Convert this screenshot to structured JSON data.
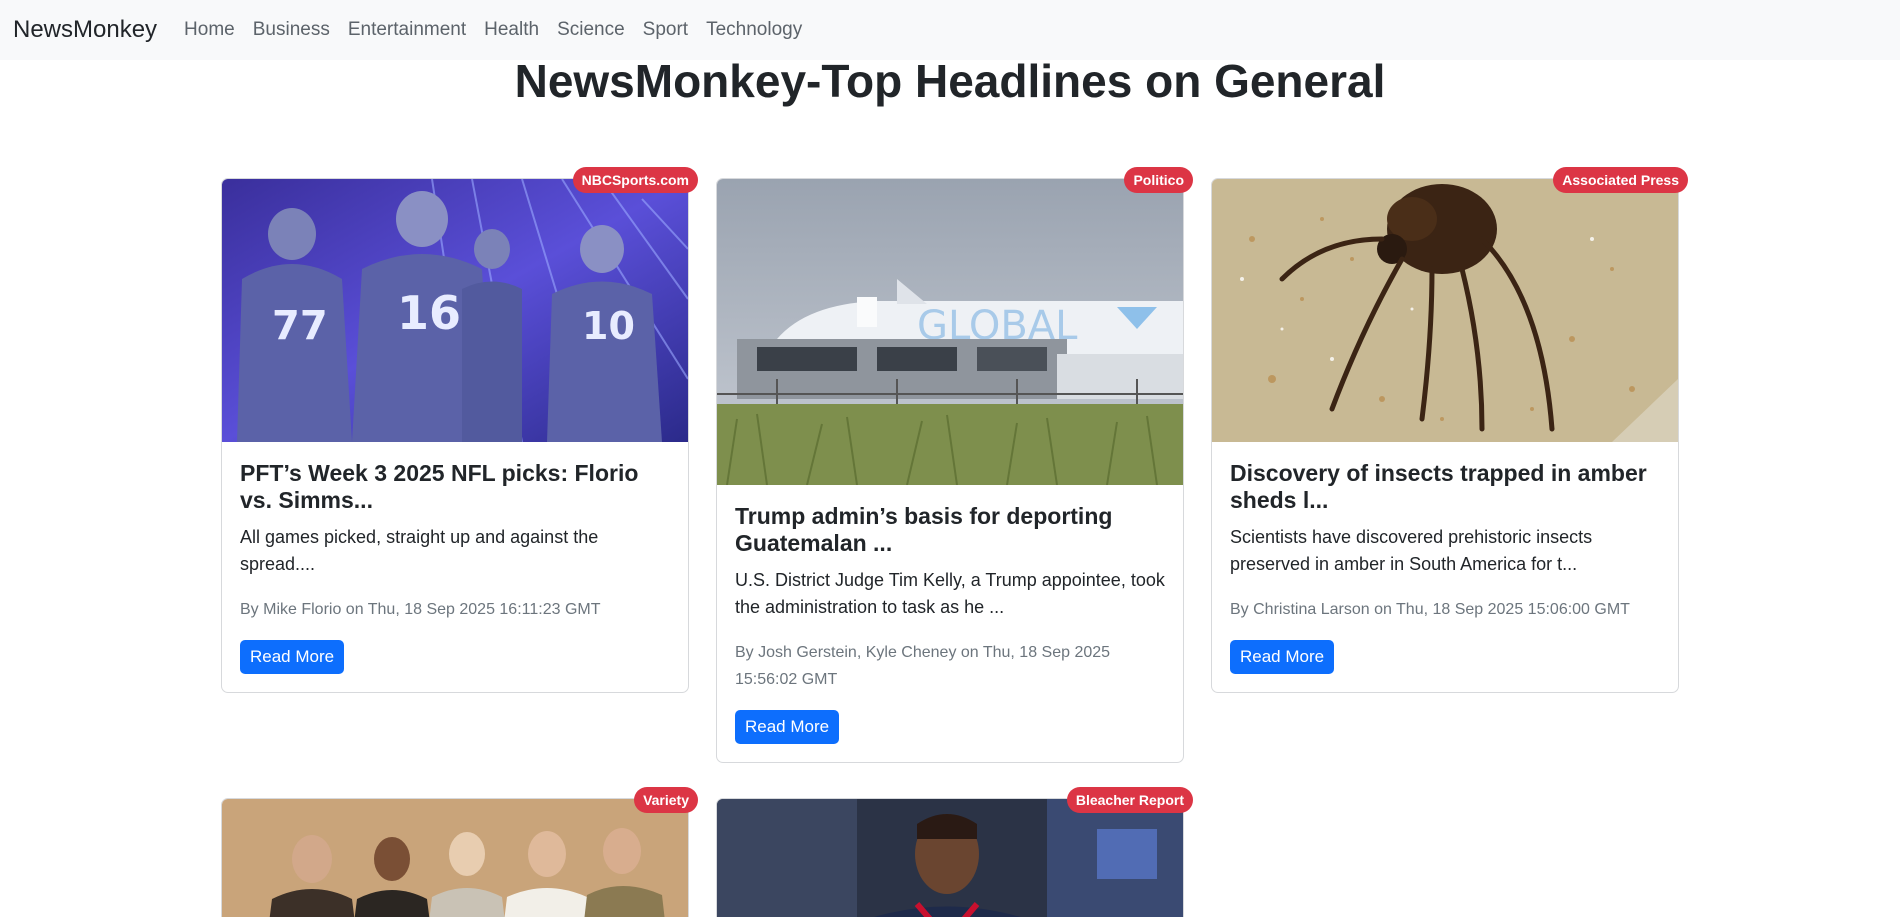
{
  "navbar": {
    "brand": "NewsMonkey",
    "links": [
      "Home",
      "Business",
      "Entertainment",
      "Health",
      "Science",
      "Sport",
      "Technology"
    ]
  },
  "page": {
    "title": "NewsMonkey-Top Headlines on General"
  },
  "articles": [
    {
      "source": "NBCSports.com",
      "title": "PFT’s Week 3 2025 NFL picks: Florio vs. Simms...",
      "description": "All games picked, straight up and against the spread....",
      "meta": "By Mike Florio on Thu, 18 Sep 2025 16:11:23 GMT",
      "button": "Read More"
    },
    {
      "source": "Politico",
      "title": "Trump admin’s basis for deporting Guatemalan ...",
      "description": "U.S. District Judge Tim Kelly, a Trump appointee, took the administration to task as he ...",
      "meta": "By Josh Gerstein, Kyle Cheney on Thu, 18 Sep 2025 15:56:02 GMT",
      "button": "Read More"
    },
    {
      "source": "Associated Press",
      "title": "Discovery of insects trapped in amber sheds l...",
      "description": "Scientists have discovered prehistoric insects preserved in amber in South America for t...",
      "meta": "By Christina Larson on Thu, 18 Sep 2025 15:06:00 GMT",
      "button": "Read More"
    },
    {
      "source": "Variety"
    },
    {
      "source": "Bleacher Report"
    }
  ],
  "images": {
    "jersey_numbers": [
      "77",
      "16",
      "10"
    ],
    "plane_text": "GLOBAL"
  },
  "colors": {
    "navbar_bg": "#f8f9fa",
    "badge": "#dc3545",
    "button": "#0d6efd"
  }
}
